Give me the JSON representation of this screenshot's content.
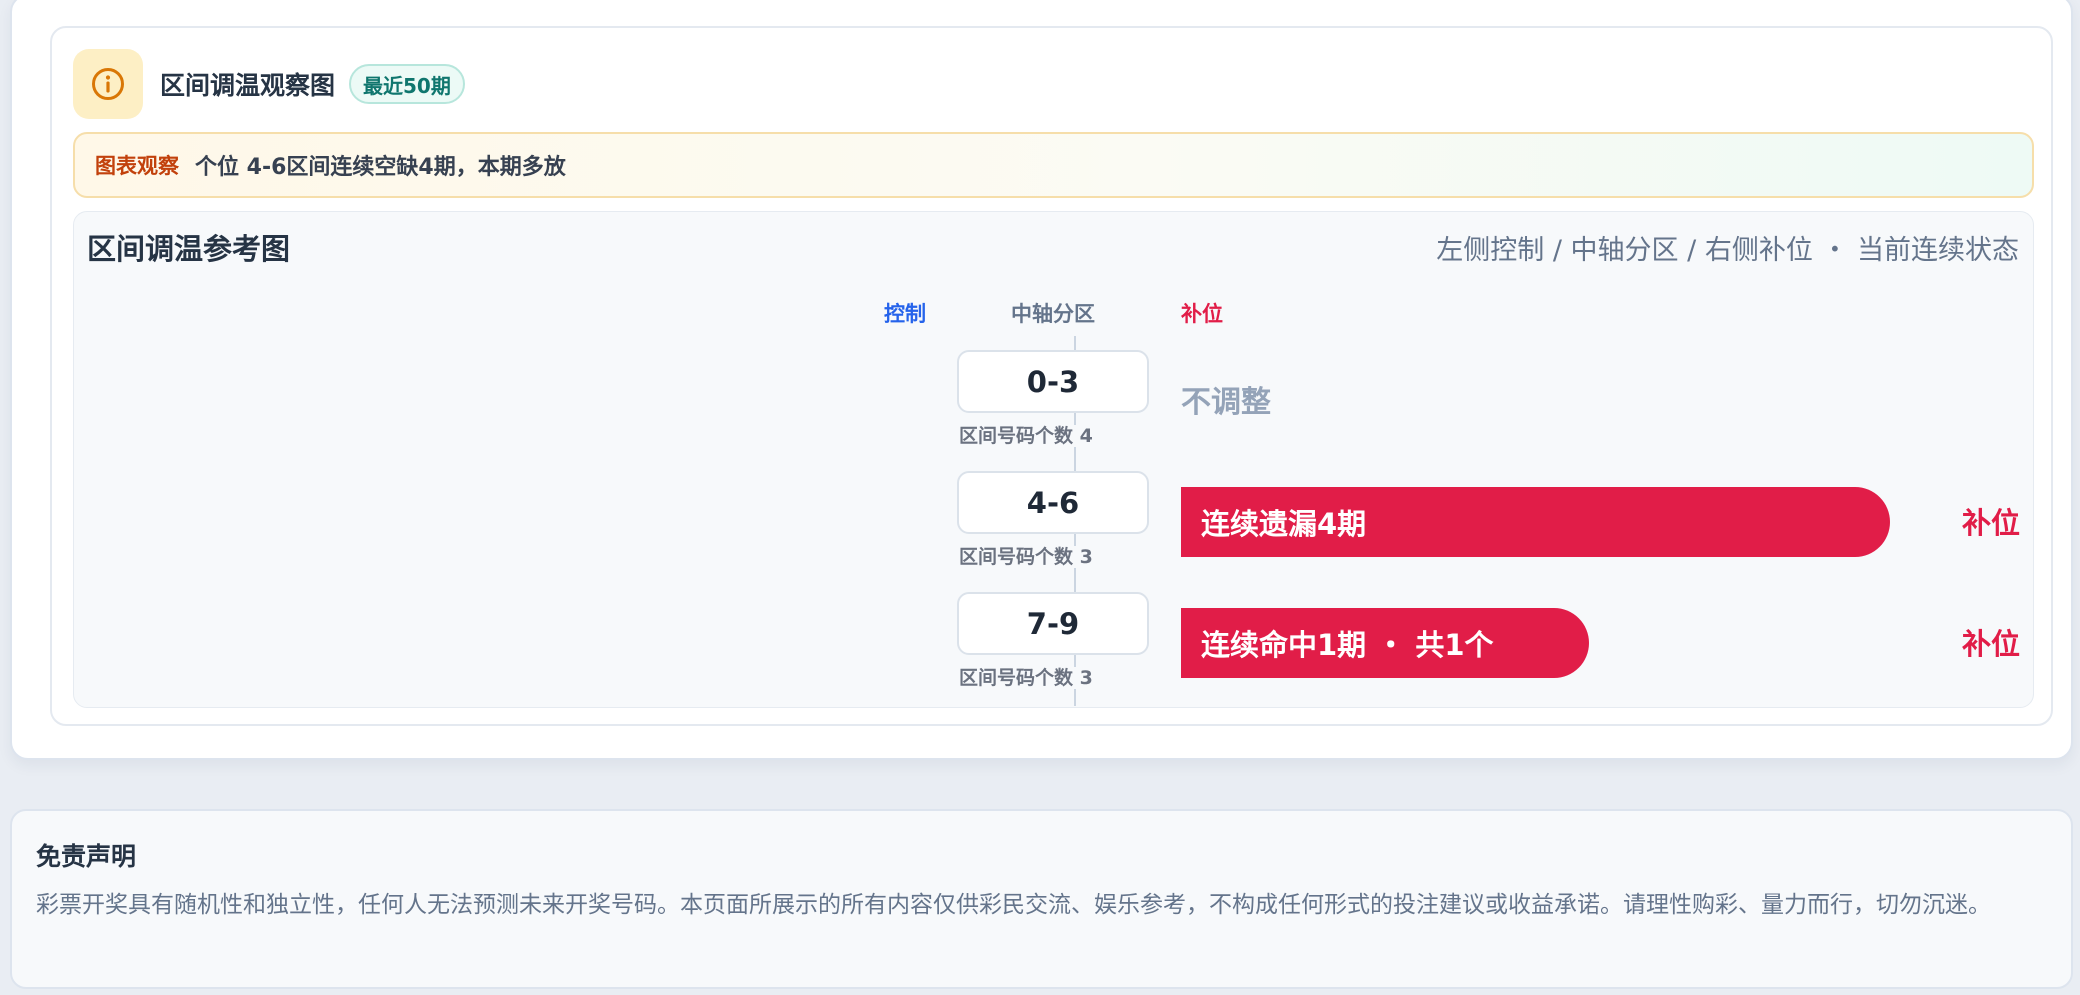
{
  "header": {
    "icon": "info-icon",
    "title": "区间调温观察图",
    "badge": "最近50期"
  },
  "observation": {
    "label": "图表观察",
    "text": "个位 4-6区间连续空缺4期，本期多放"
  },
  "reference": {
    "title": "区间调温参考图",
    "description": "左侧控制 / 中轴分区 / 右侧补位 ・ 当前连续状态",
    "columns": {
      "control": "控制",
      "axis": "中轴分区",
      "fill": "补位"
    },
    "rows": [
      {
        "range": "0-3",
        "count_label": "区间号码个数 4",
        "status": "不调整",
        "status_type": "none",
        "bar_fraction": 0,
        "tag": ""
      },
      {
        "range": "4-6",
        "count_label": "区间号码个数 3",
        "status": "连续遗漏4期",
        "status_type": "fill",
        "bar_fraction": 0.87,
        "tag": "补位"
      },
      {
        "range": "7-9",
        "count_label": "区间号码个数 3",
        "status": "连续命中1期 ・ 共1个",
        "status_type": "fill",
        "bar_fraction": 0.5,
        "tag": "补位"
      }
    ]
  },
  "colors": {
    "accent_fill": "#e11d48",
    "accent_control": "#2563eb",
    "badge_green": "#0f766e",
    "warn_orange": "#c2410c"
  },
  "disclaimer": {
    "title": "免责声明",
    "body": "彩票开奖具有随机性和独立性，任何人无法预测未来开奖号码。本页面所展示的所有内容仅供彩民交流、娱乐参考，不构成任何形式的投注建议或收益承诺。请理性购彩、量力而行，切勿沉迷。"
  }
}
